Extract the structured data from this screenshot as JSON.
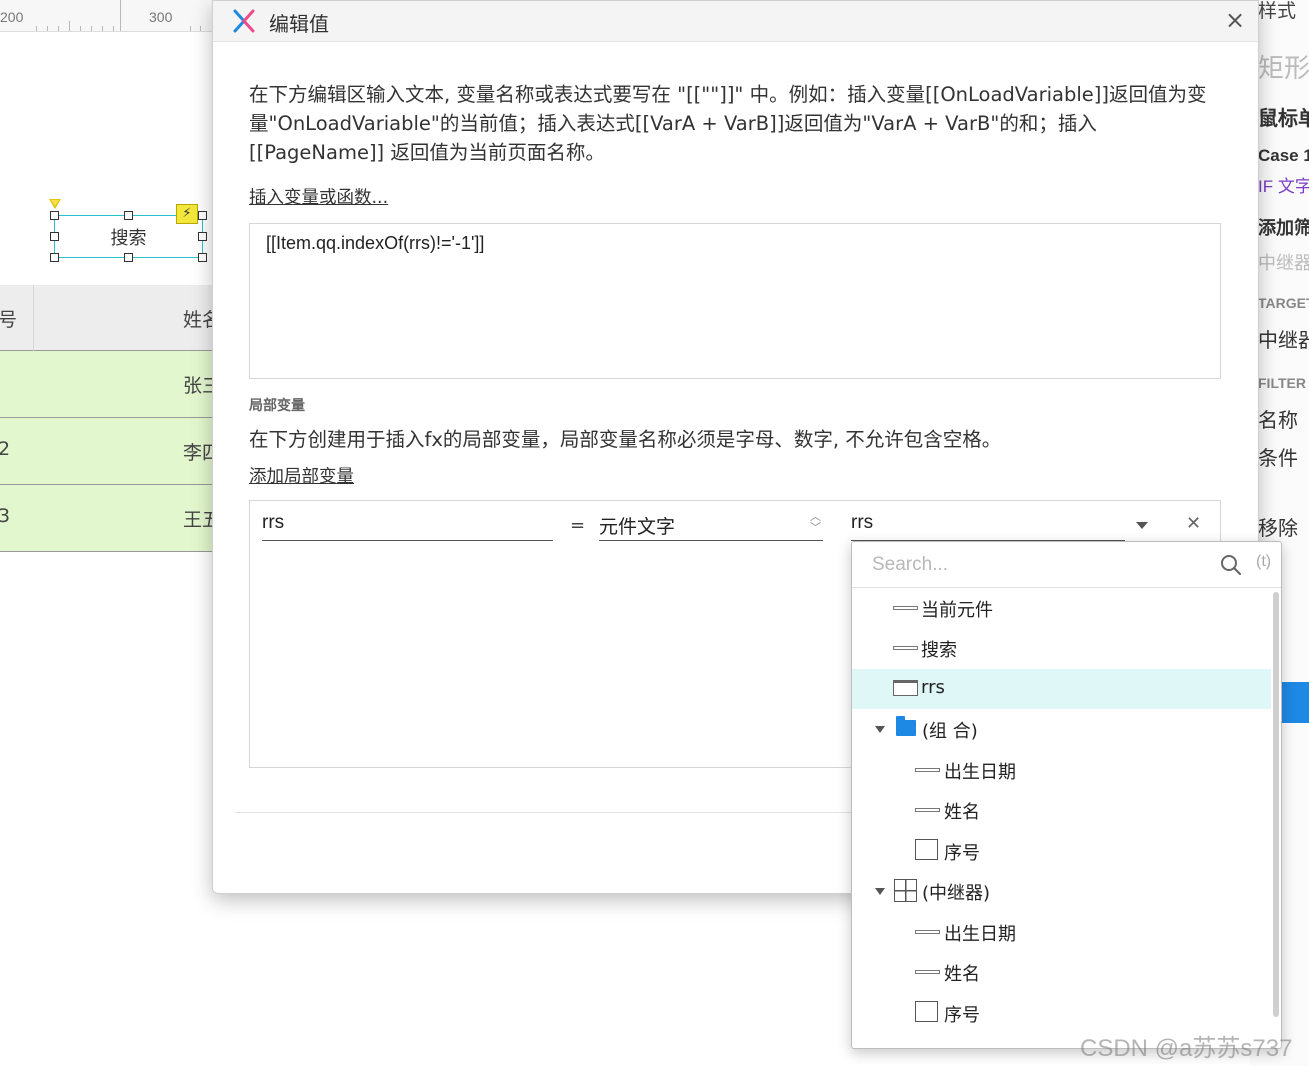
{
  "background": {
    "ruler": {
      "marks": [
        "200",
        "300"
      ]
    },
    "canvas_widget": {
      "label": "搜索"
    },
    "table": {
      "headers": [
        "号",
        "姓名"
      ],
      "rows": [
        {
          "c1": "",
          "c2": "张三"
        },
        {
          "c1": "2",
          "c2": "李四"
        },
        {
          "c1": "3",
          "c2": "王五"
        }
      ]
    },
    "inspector": {
      "items": [
        "样式",
        "矩形",
        "鼠标单击时",
        "Case 1",
        "IF 文字",
        "添加筛选",
        "中继器",
        "TARGET",
        "中继器",
        "FILTER",
        "名称",
        "条件",
        "移除"
      ]
    }
  },
  "dialog": {
    "title": "编辑值",
    "instructions": "在下方编辑区输入文本, 变量名称或表达式要写在 \"[[\"\"]]\" 中。例如：插入变量[[OnLoadVariable]]返回值为变量\"OnLoadVariable\"的当前值；插入表达式[[VarA + VarB]]返回值为\"VarA + VarB\"的和；插入[[PageName]] 返回值为当前页面名称。",
    "insert_link": "插入变量或函数...",
    "editor_value": "[[Item.qq.indexOf(rrs)!='-1']]",
    "local_vars": {
      "section_label": "局部变量",
      "description": "在下方创建用于插入fx的局部变量，局部变量名称必须是字母、数字, 不允许包含空格。",
      "add_link": "添加局部变量",
      "variable": {
        "name": "rrs",
        "equals": "=",
        "type": "元件文字",
        "target": "rrs"
      }
    }
  },
  "dropdown": {
    "search_placeholder": "Search...",
    "fx_label": "(t)",
    "items": [
      {
        "label": "当前元件",
        "icon": "line-icon"
      },
      {
        "label": "搜索",
        "icon": "line-icon"
      },
      {
        "label": "rrs",
        "icon": "text-field-icon",
        "selected": true
      },
      {
        "label": "(组 合)",
        "icon": "folder-icon",
        "expanded": true
      },
      {
        "label": "出生日期",
        "icon": "line-icon"
      },
      {
        "label": "姓名",
        "icon": "line-icon"
      },
      {
        "label": "序号",
        "icon": "box-icon"
      },
      {
        "label": "(中继器)",
        "icon": "repeater-icon",
        "expanded": true
      },
      {
        "label": "出生日期",
        "icon": "line-icon"
      },
      {
        "label": "姓名",
        "icon": "line-icon"
      },
      {
        "label": "序号",
        "icon": "box-icon"
      }
    ]
  },
  "watermark": "CSDN @a苏苏s737",
  "colors": {
    "accent": "#1e88e5",
    "selection": "#dff7f7",
    "table_row": "#e3f7ce",
    "widget_border": "#25c2cf"
  }
}
